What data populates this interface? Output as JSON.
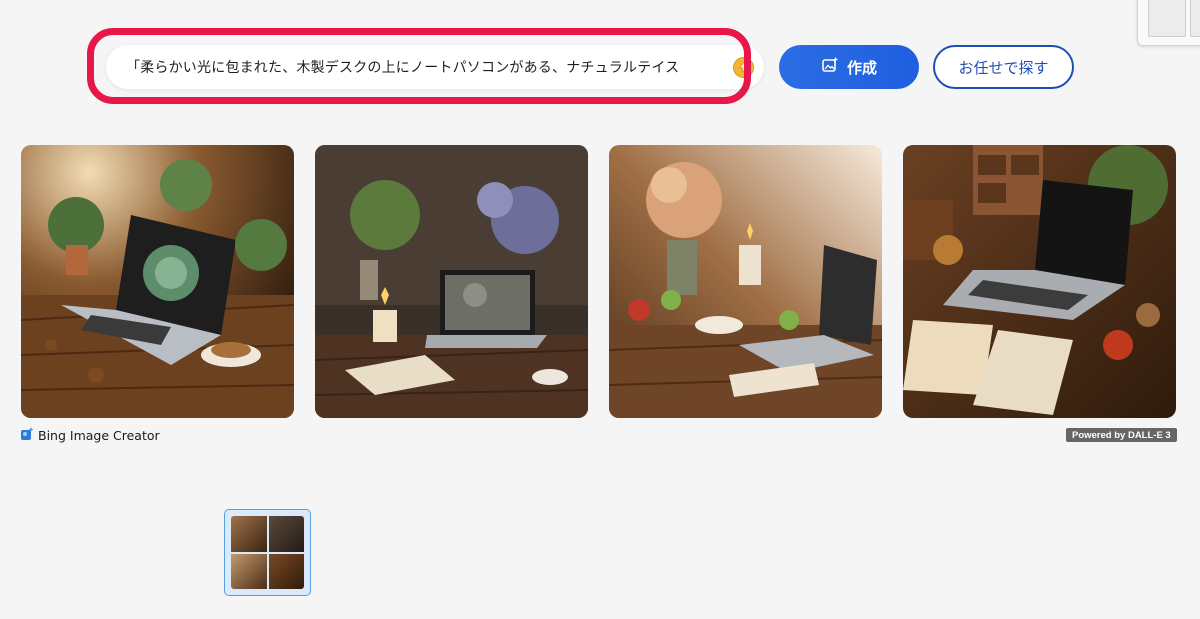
{
  "search": {
    "prompt": "「柔らかい光に包まれた、木製デスクの上にノートパソコンがある、ナチュラルテイス",
    "boost_icon": "coin-icon"
  },
  "buttons": {
    "create_label": "作成",
    "create_icon": "image-sparkle-icon",
    "surprise_label": "お任せで探す"
  },
  "results": {
    "images": [
      {
        "subject": "laptop with succulent wallpaper, coffee cup, ferns"
      },
      {
        "subject": "laptop with forest wallpaper, candles, notebook, flowers"
      },
      {
        "subject": "laptop, dried flowers, apples, teacup, scroll"
      },
      {
        "subject": "open laptop, notebooks, apple, wooden drawers, plants"
      }
    ],
    "brand_label": "Bing Image Creator",
    "powered_label": "Powered by DALL-E 3"
  },
  "colors": {
    "highlight": "#e8174a",
    "accent": "#1f5fe0"
  }
}
